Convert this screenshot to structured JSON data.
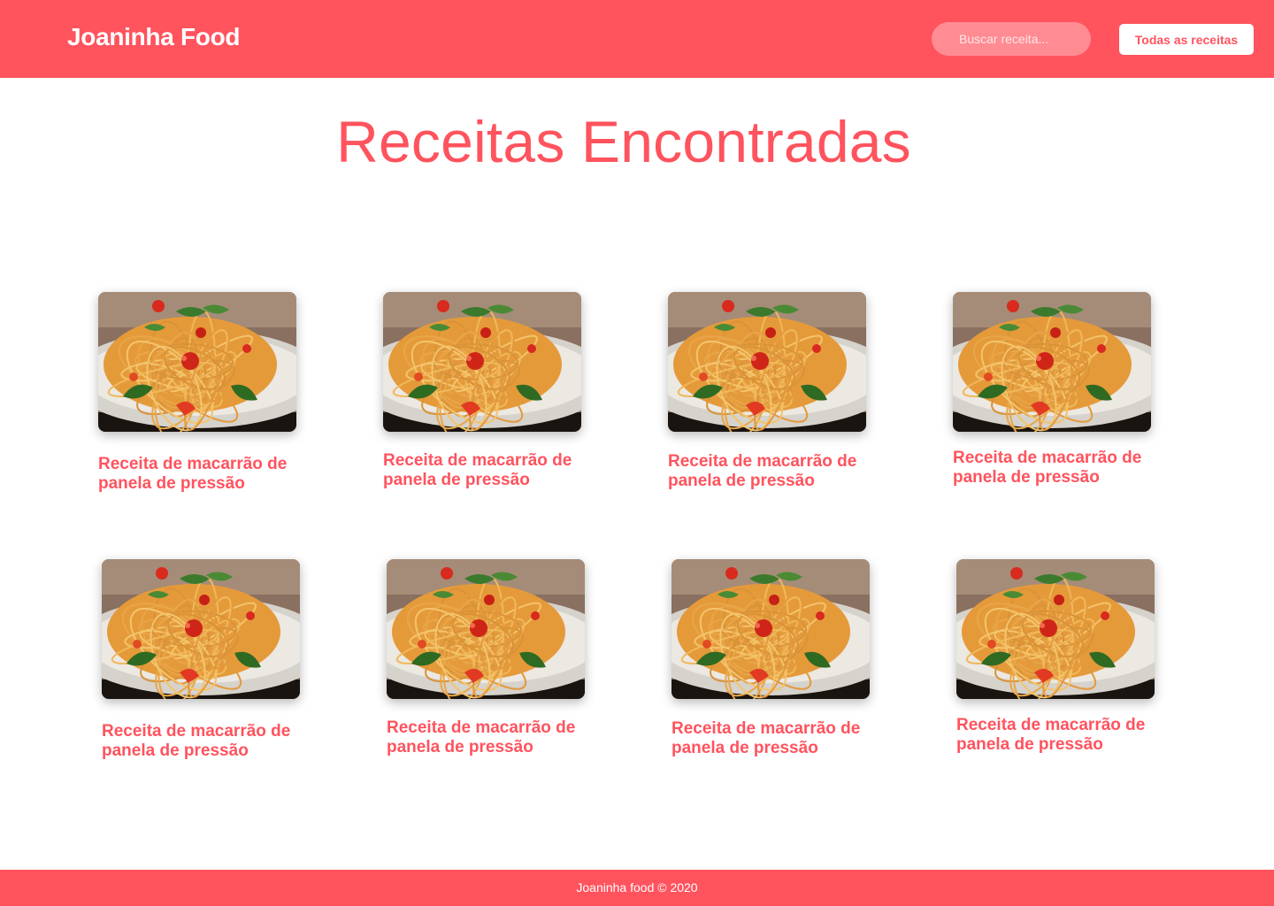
{
  "header": {
    "brand": "Joaninha Food",
    "search_placeholder": "Buscar receita...",
    "all_recipes_label": "Todas as receitas"
  },
  "main": {
    "title": "Receitas Encontradas",
    "recipes": [
      {
        "title": "Receita de macarrão de panela de pressão",
        "image": "spaghetti-photo"
      },
      {
        "title": "Receita de macarrão de panela de pressão",
        "image": "spaghetti-photo"
      },
      {
        "title": "Receita de macarrão de panela de pressão",
        "image": "spaghetti-photo"
      },
      {
        "title": "Receita de macarrão de panela de pressão",
        "image": "spaghetti-photo"
      },
      {
        "title": "Receita de macarrão de panela de pressão",
        "image": "spaghetti-photo"
      },
      {
        "title": "Receita de macarrão de panela de pressão",
        "image": "spaghetti-photo"
      },
      {
        "title": "Receita de macarrão de panela de pressão",
        "image": "spaghetti-photo"
      },
      {
        "title": "Receita de macarrão de panela de pressão",
        "image": "spaghetti-photo"
      }
    ]
  },
  "footer": {
    "text": "Joaninha food © 2020"
  },
  "colors": {
    "brand": "#ff535e",
    "search_bg": "#ff8c93",
    "background": "#ffffff"
  }
}
